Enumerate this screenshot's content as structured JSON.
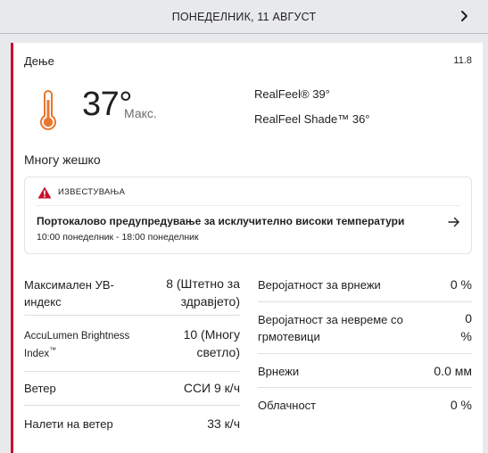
{
  "topbar": {
    "date": "ПОНЕДЕЛНИК, 11 АВГУСТ",
    "next_icon": "chevron-right-icon"
  },
  "card": {
    "day_label": "Дење",
    "date_short": "11.8",
    "accent_color": "#c8102e",
    "icon": "thermometer-hot-icon",
    "temperature": "37°",
    "temp_suffix": "Макс.",
    "realfeel": "RealFeel® 39°",
    "realfeel_shade": "RealFeel Shade™ 36°",
    "phrase": "Многу жешко"
  },
  "alerts": {
    "title": "ИЗВЕСТУВАЊА",
    "icon": "warning-triangle-icon",
    "headline": "Портокалово предупредување за исклучително високи температури",
    "time": "10:00 понеделник - 18:00 понеделник",
    "arrow_icon": "arrow-right-icon"
  },
  "details_left": [
    {
      "label": "Максимален УВ-индекс",
      "value": "8 (Штетно за здравјето)"
    },
    {
      "label": "AccuLumen Brightness Index",
      "label_mark": "™",
      "value": "10 (Многу светло)"
    },
    {
      "label": "Ветер",
      "value": "ССИ 9 к/ч"
    },
    {
      "label": "Налети на ветер",
      "value": "33 к/ч"
    }
  ],
  "details_right": [
    {
      "label": "Веројатност за врнежи",
      "value": "0 %"
    },
    {
      "label": "Веројатност за невреме со грмотевици",
      "value": "0 %"
    },
    {
      "label": "Врнежи",
      "value": "0.0 мм"
    },
    {
      "label": "Облачност",
      "value": "0 %"
    }
  ]
}
